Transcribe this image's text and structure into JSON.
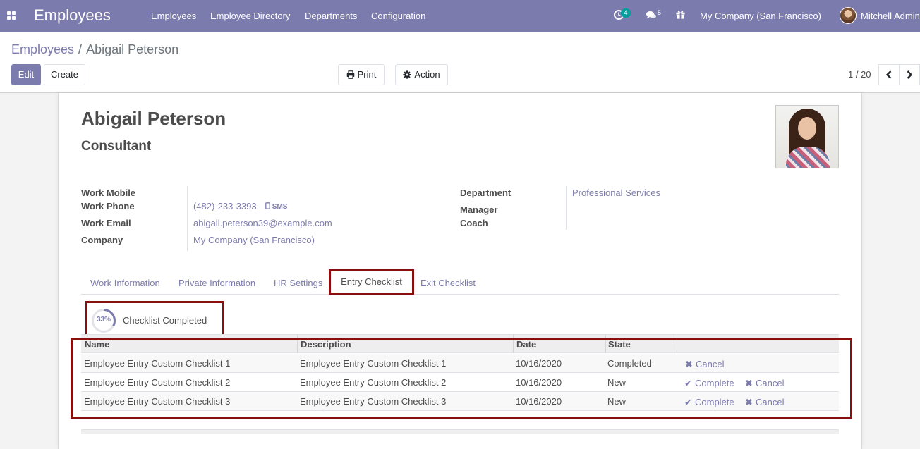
{
  "navbar": {
    "app_title": "Employees",
    "menu": [
      "Employees",
      "Employee Directory",
      "Departments",
      "Configuration"
    ],
    "activity_count": "4",
    "messages_count": "5",
    "company": "My Company (San Francisco)",
    "user": "Mitchell Admin",
    "bg_color": "#7c7bad",
    "icons": [
      "apps-icon",
      "clock-icon",
      "chat-icon",
      "gift-icon"
    ]
  },
  "breadcrumb": {
    "parent": "Employees",
    "separator": "/",
    "current": "Abigail Peterson"
  },
  "toolbar": {
    "edit": "Edit",
    "create": "Create",
    "print": "Print",
    "action": "Action"
  },
  "pager": {
    "value": "1 / 20"
  },
  "employee": {
    "name": "Abigail Peterson",
    "job_title": "Consultant",
    "fields_left": [
      {
        "label": "Work Mobile",
        "value": ""
      },
      {
        "label": "Work Phone",
        "value": "(482)-233-3393"
      },
      {
        "label": "Work Email",
        "value": "abigail.peterson39@example.com"
      },
      {
        "label": "Company",
        "value": "My Company (San Francisco)"
      }
    ],
    "sms_label": "SMS",
    "fields_right": [
      {
        "label": "Department",
        "value": "Professional Services"
      },
      {
        "label": "Manager",
        "value": ""
      },
      {
        "label": "Coach",
        "value": ""
      }
    ]
  },
  "tabs": [
    {
      "label": "Work Information",
      "active": false
    },
    {
      "label": "Private Information",
      "active": false
    },
    {
      "label": "HR Settings",
      "active": false
    },
    {
      "label": "Entry Checklist",
      "active": true
    },
    {
      "label": "Exit Checklist",
      "active": false
    }
  ],
  "checklist_progress": {
    "percent": 33,
    "percent_label": "33%",
    "label": "Checklist Completed"
  },
  "checklist_table": {
    "columns": [
      "Name",
      "Description",
      "Date",
      "State"
    ],
    "rows": [
      {
        "name": "Employee Entry Custom Checklist 1",
        "description": "Employee Entry Custom Checklist 1",
        "date": "10/16/2020",
        "state": "Completed",
        "actions": [
          "Cancel"
        ]
      },
      {
        "name": "Employee Entry Custom Checklist 2",
        "description": "Employee Entry Custom Checklist 2",
        "date": "10/16/2020",
        "state": "New",
        "actions": [
          "Complete",
          "Cancel"
        ]
      },
      {
        "name": "Employee Entry Custom Checklist 3",
        "description": "Employee Entry Custom Checklist 3",
        "date": "10/16/2020",
        "state": "New",
        "actions": [
          "Complete",
          "Cancel"
        ]
      }
    ]
  },
  "highlight_color": "#8b0e0e",
  "accent_color": "#7c7bad"
}
